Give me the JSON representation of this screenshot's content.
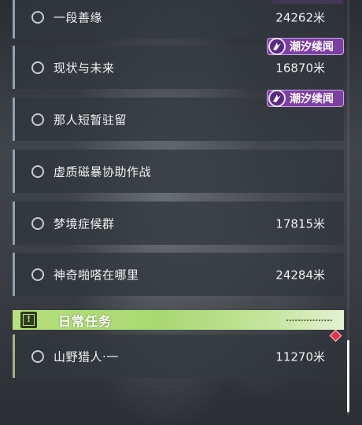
{
  "quests": [
    {
      "name": "一段善缘",
      "distance": "24262米",
      "badge": ""
    },
    {
      "name": "现状与未来",
      "distance": "16870米",
      "badge": "潮汐续闻"
    },
    {
      "name": "那人短暂驻留",
      "distance": "",
      "badge": "潮汐续闻"
    },
    {
      "name": "虚质磁暴协助作战",
      "distance": "",
      "badge": ""
    },
    {
      "name": "梦境症候群",
      "distance": "17815米",
      "badge": ""
    },
    {
      "name": "神奇啪嗒在哪里",
      "distance": "24284米",
      "badge": ""
    }
  ],
  "daily_section": {
    "title": "日常任务",
    "icon": "exclamation-box-icon",
    "accent_color": "#b6e07c"
  },
  "daily_quests": [
    {
      "name": "山野猎人·一",
      "distance": "11270米"
    }
  ],
  "colors": {
    "badge_purple": "#7c3fa3",
    "tracked_marker": "#e8324a"
  }
}
